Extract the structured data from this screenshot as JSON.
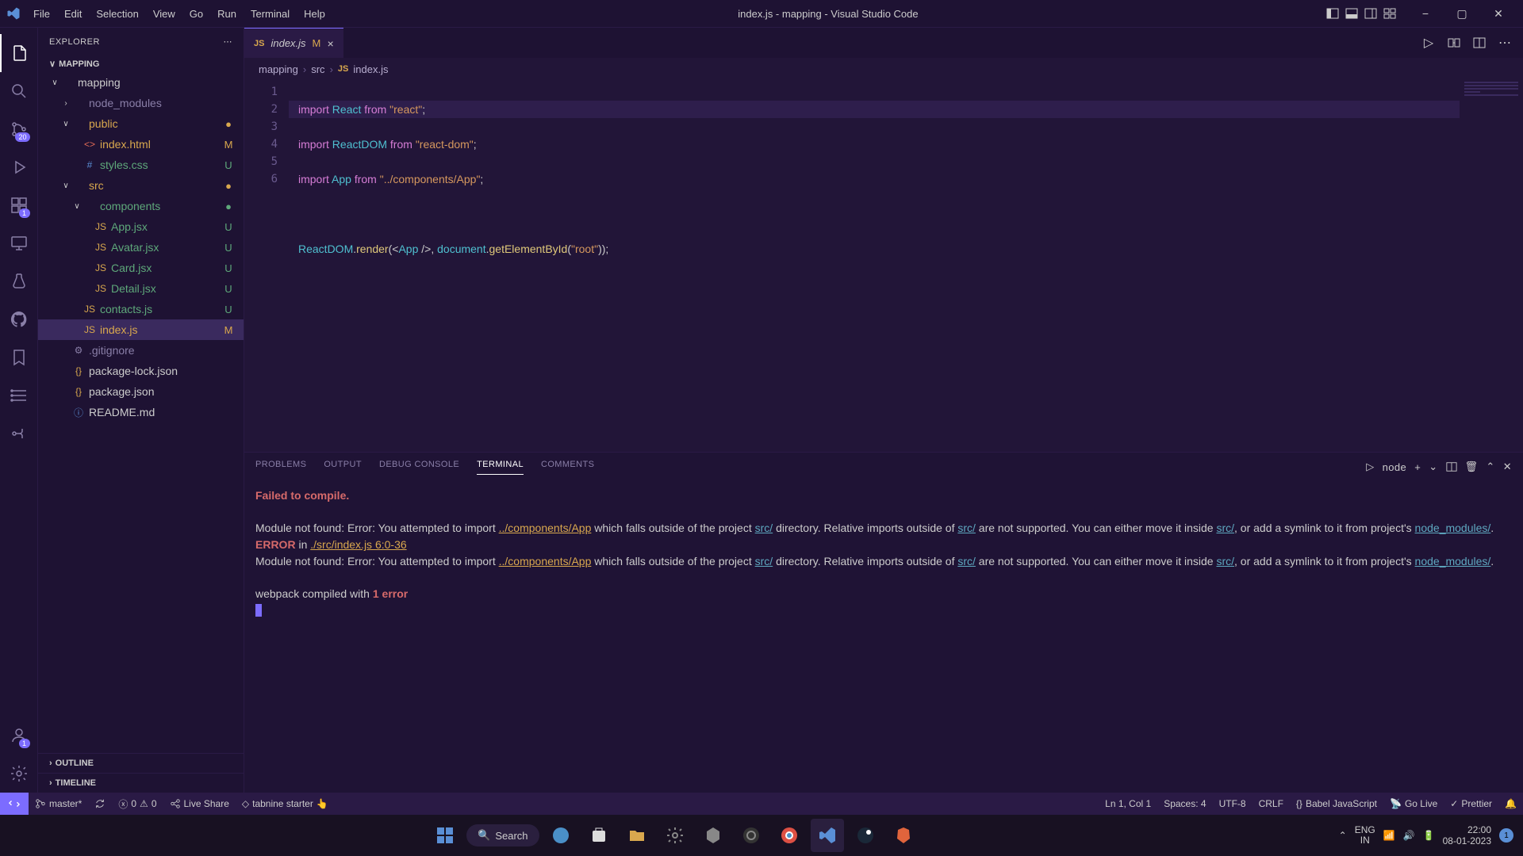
{
  "titlebar": {
    "menu": [
      "File",
      "Edit",
      "Selection",
      "View",
      "Go",
      "Run",
      "Terminal",
      "Help"
    ],
    "title": "index.js - mapping - Visual Studio Code"
  },
  "activity_badges": {
    "scm": "20",
    "extensions": "1",
    "accounts": "1"
  },
  "sidebar": {
    "header": "EXPLORER",
    "project": "MAPPING",
    "tree": [
      {
        "indent": 1,
        "chev": "∨",
        "icon": "",
        "label": "mapping",
        "status": "",
        "statusClass": "",
        "muted": false
      },
      {
        "indent": 2,
        "chev": "›",
        "icon": "",
        "label": "node_modules",
        "status": "",
        "statusClass": "",
        "muted": true
      },
      {
        "indent": 2,
        "chev": "∨",
        "icon": "",
        "label": "public",
        "status": "●",
        "statusClass": "status-m",
        "muted": false
      },
      {
        "indent": 3,
        "chev": "",
        "icon": "<>",
        "iconColor": "#e06a56",
        "label": "index.html",
        "status": "M",
        "statusClass": "status-m",
        "muted": false
      },
      {
        "indent": 3,
        "chev": "",
        "icon": "#",
        "iconColor": "#5a8fd6",
        "label": "styles.css",
        "status": "U",
        "statusClass": "status-u",
        "muted": false
      },
      {
        "indent": 2,
        "chev": "∨",
        "icon": "",
        "label": "src",
        "status": "●",
        "statusClass": "status-m",
        "muted": false
      },
      {
        "indent": 3,
        "chev": "∨",
        "icon": "",
        "label": "components",
        "status": "●",
        "statusClass": "status-u",
        "muted": false
      },
      {
        "indent": 4,
        "chev": "",
        "icon": "JS",
        "iconColor": "#d9a84e",
        "label": "App.jsx",
        "status": "U",
        "statusClass": "status-u",
        "muted": false
      },
      {
        "indent": 4,
        "chev": "",
        "icon": "JS",
        "iconColor": "#d9a84e",
        "label": "Avatar.jsx",
        "status": "U",
        "statusClass": "status-u",
        "muted": false
      },
      {
        "indent": 4,
        "chev": "",
        "icon": "JS",
        "iconColor": "#d9a84e",
        "label": "Card.jsx",
        "status": "U",
        "statusClass": "status-u",
        "muted": false
      },
      {
        "indent": 4,
        "chev": "",
        "icon": "JS",
        "iconColor": "#d9a84e",
        "label": "Detail.jsx",
        "status": "U",
        "statusClass": "status-u",
        "muted": false
      },
      {
        "indent": 3,
        "chev": "",
        "icon": "JS",
        "iconColor": "#d9a84e",
        "label": "contacts.js",
        "status": "U",
        "statusClass": "status-u",
        "muted": false
      },
      {
        "indent": 3,
        "chev": "",
        "icon": "JS",
        "iconColor": "#d9a84e",
        "label": "index.js",
        "status": "M",
        "statusClass": "status-m",
        "muted": false,
        "selected": true
      },
      {
        "indent": 2,
        "chev": "",
        "icon": "⚙",
        "iconColor": "#8a7fa8",
        "label": ".gitignore",
        "status": "",
        "statusClass": "",
        "muted": true
      },
      {
        "indent": 2,
        "chev": "",
        "icon": "{}",
        "iconColor": "#d9a84e",
        "label": "package-lock.json",
        "status": "",
        "statusClass": "",
        "muted": false
      },
      {
        "indent": 2,
        "chev": "",
        "icon": "{}",
        "iconColor": "#d9a84e",
        "label": "package.json",
        "status": "",
        "statusClass": "",
        "muted": false
      },
      {
        "indent": 2,
        "chev": "",
        "icon": "ⓘ",
        "iconColor": "#5a8fd6",
        "label": "README.md",
        "status": "",
        "statusClass": "",
        "muted": false
      }
    ],
    "outline": "OUTLINE",
    "timeline": "TIMELINE"
  },
  "tab": {
    "icon": "JS",
    "name": "index.js",
    "status": "M"
  },
  "breadcrumbs": [
    "mapping",
    "src",
    "index.js"
  ],
  "breadcrumb_icon": "JS",
  "panel": {
    "tabs": [
      "PROBLEMS",
      "OUTPUT",
      "DEBUG CONSOLE",
      "TERMINAL",
      "COMMENTS"
    ],
    "active_tab": 3,
    "shell": "node",
    "terminal": {
      "failed": "Failed to compile.",
      "module_not_found_prefix": "Module not found: Error: You attempted to import ",
      "app_path": "../components/App",
      "mid1": " which falls outside of the project ",
      "src": "src/",
      "mid2": " directory. Relative imports outside of ",
      "tail": " are not supported. You can either move it inside ",
      "tail2": ", or add a symlink to it from project's ",
      "node_modules": "node_modules/",
      "dot": ".",
      "error_word": "ERROR",
      "error_in": " in ",
      "error_loc": "./src/index.js 6:0-36",
      "webpack": "webpack compiled with ",
      "one_error": "1 error"
    }
  },
  "statusbar": {
    "branch": "master*",
    "sync": "",
    "errors": "0",
    "warnings": "0",
    "liveshare": "Live Share",
    "tabnine": "tabnine starter",
    "position": "Ln 1, Col 1",
    "spaces": "Spaces: 4",
    "encoding": "UTF-8",
    "eol": "CRLF",
    "lang": "Babel JavaScript",
    "golive": "Go Live",
    "prettier": "Prettier"
  },
  "taskbar": {
    "search": "Search",
    "lang1": "ENG",
    "lang2": "IN",
    "time": "22:00",
    "date": "08-01-2023",
    "notif_count": "1"
  }
}
